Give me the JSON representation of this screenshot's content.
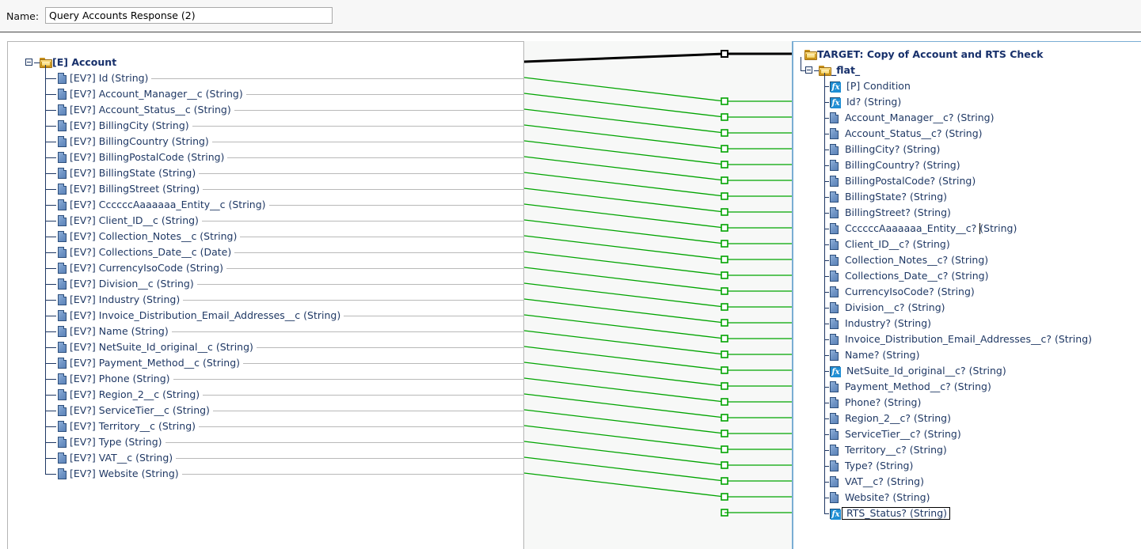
{
  "header": {
    "name_label": "Name:",
    "name_value": "Query Accounts Response (2)",
    "name_placeholder": "Name"
  },
  "colors": {
    "link_line": "#00a400",
    "root_link_line": "#000000",
    "tree_text": "#1f3864",
    "grey_connector": "#b9b9b9",
    "target_border": "#7aadd4",
    "folder_icon": "#f2c14e",
    "field_icon": "#6e93c4",
    "function_icon": "#1f8ed4"
  },
  "source_tree": {
    "root": {
      "label": "[E] Account",
      "icon": "folder-icon",
      "expanded": true
    },
    "fields": [
      {
        "label": "[EV?] Id (String)",
        "icon": "field-icon"
      },
      {
        "label": "[EV?] Account_Manager__c (String)",
        "icon": "field-icon"
      },
      {
        "label": "[EV?] Account_Status__c (String)",
        "icon": "field-icon"
      },
      {
        "label": "[EV?] BillingCity (String)",
        "icon": "field-icon"
      },
      {
        "label": "[EV?] BillingCountry (String)",
        "icon": "field-icon"
      },
      {
        "label": "[EV?] BillingPostalCode (String)",
        "icon": "field-icon"
      },
      {
        "label": "[EV?] BillingState (String)",
        "icon": "field-icon"
      },
      {
        "label": "[EV?] BillingStreet (String)",
        "icon": "field-icon"
      },
      {
        "label": "[EV?] CcccccAaaaaaa_Entity__c (String)",
        "icon": "field-icon"
      },
      {
        "label": "[EV?] Client_ID__c (String)",
        "icon": "field-icon"
      },
      {
        "label": "[EV?] Collection_Notes__c (String)",
        "icon": "field-icon"
      },
      {
        "label": "[EV?] Collections_Date__c (Date)",
        "icon": "field-icon"
      },
      {
        "label": "[EV?] CurrencyIsoCode (String)",
        "icon": "field-icon"
      },
      {
        "label": "[EV?] Division__c (String)",
        "icon": "field-icon"
      },
      {
        "label": "[EV?] Industry (String)",
        "icon": "field-icon"
      },
      {
        "label": "[EV?] Invoice_Distribution_Email_Addresses__c (String)",
        "icon": "field-icon"
      },
      {
        "label": "[EV?] Name (String)",
        "icon": "field-icon"
      },
      {
        "label": "[EV?] NetSuite_Id_original__c (String)",
        "icon": "field-icon"
      },
      {
        "label": "[EV?] Payment_Method__c (String)",
        "icon": "field-icon"
      },
      {
        "label": "[EV?] Phone (String)",
        "icon": "field-icon"
      },
      {
        "label": "[EV?] Region_2__c (String)",
        "icon": "field-icon"
      },
      {
        "label": "[EV?] ServiceTier__c (String)",
        "icon": "field-icon"
      },
      {
        "label": "[EV?] Territory__c (String)",
        "icon": "field-icon"
      },
      {
        "label": "[EV?] Type (String)",
        "icon": "field-icon"
      },
      {
        "label": "[EV?] VAT__c (String)",
        "icon": "field-icon"
      },
      {
        "label": "[EV?] Website (String)",
        "icon": "field-icon"
      }
    ]
  },
  "target_tree": {
    "root": {
      "label": "TARGET: Copy of Account and RTS Check",
      "icon": "folder-icon"
    },
    "group": {
      "label": "_flat_",
      "icon": "folder-icon",
      "expanded": true
    },
    "fields": [
      {
        "label": "[P] Condition",
        "icon": "function-icon",
        "selected": false
      },
      {
        "label": "Id? (String)",
        "icon": "function-icon",
        "selected": false
      },
      {
        "label": "Account_Manager__c? (String)",
        "icon": "field-icon",
        "selected": false
      },
      {
        "label": "Account_Status__c? (String)",
        "icon": "field-icon",
        "selected": false
      },
      {
        "label": "BillingCity? (String)",
        "icon": "field-icon",
        "selected": false
      },
      {
        "label": "BillingCountry? (String)",
        "icon": "field-icon",
        "selected": false
      },
      {
        "label": "BillingPostalCode? (String)",
        "icon": "field-icon",
        "selected": false
      },
      {
        "label": "BillingState? (String)",
        "icon": "field-icon",
        "selected": false
      },
      {
        "label": "BillingStreet? (String)",
        "icon": "field-icon",
        "selected": false
      },
      {
        "label": "CcccccAaaaaaa_Entity__c? (String)",
        "icon": "field-icon",
        "selected": false,
        "caret": true
      },
      {
        "label": "Client_ID__c? (String)",
        "icon": "field-icon",
        "selected": false
      },
      {
        "label": "Collection_Notes__c? (String)",
        "icon": "field-icon",
        "selected": false
      },
      {
        "label": "Collections_Date__c? (String)",
        "icon": "field-icon",
        "selected": false
      },
      {
        "label": "CurrencyIsoCode? (String)",
        "icon": "field-icon",
        "selected": false
      },
      {
        "label": "Division__c? (String)",
        "icon": "field-icon",
        "selected": false
      },
      {
        "label": "Industry? (String)",
        "icon": "field-icon",
        "selected": false
      },
      {
        "label": "Invoice_Distribution_Email_Addresses__c? (String)",
        "icon": "field-icon",
        "selected": false
      },
      {
        "label": "Name? (String)",
        "icon": "field-icon",
        "selected": false
      },
      {
        "label": "NetSuite_Id_original__c? (String)",
        "icon": "function-icon",
        "selected": false
      },
      {
        "label": "Payment_Method__c? (String)",
        "icon": "field-icon",
        "selected": false
      },
      {
        "label": "Phone? (String)",
        "icon": "field-icon",
        "selected": false
      },
      {
        "label": "Region_2__c? (String)",
        "icon": "field-icon",
        "selected": false
      },
      {
        "label": "ServiceTier__c? (String)",
        "icon": "field-icon",
        "selected": false
      },
      {
        "label": "Territory__c? (String)",
        "icon": "field-icon",
        "selected": false
      },
      {
        "label": "Type? (String)",
        "icon": "field-icon",
        "selected": false
      },
      {
        "label": "VAT__c? (String)",
        "icon": "field-icon",
        "selected": false
      },
      {
        "label": "Website? (String)",
        "icon": "field-icon",
        "selected": false
      },
      {
        "label": "RTS_Status? (String)",
        "icon": "function-icon",
        "selected": true
      }
    ]
  },
  "mappings": {
    "root_link": {
      "source_row": -1,
      "target_row": -1,
      "color": "#000000"
    },
    "links": [
      {
        "source": "[EV?] Id (String)",
        "target": "Id? (String)"
      },
      {
        "source": "[EV?] Account_Manager__c (String)",
        "target": "Account_Manager__c? (String)"
      },
      {
        "source": "[EV?] Account_Status__c (String)",
        "target": "Account_Status__c? (String)"
      },
      {
        "source": "[EV?] BillingCity (String)",
        "target": "BillingCity? (String)"
      },
      {
        "source": "[EV?] BillingCountry (String)",
        "target": "BillingCountry? (String)"
      },
      {
        "source": "[EV?] BillingPostalCode (String)",
        "target": "BillingPostalCode? (String)"
      },
      {
        "source": "[EV?] BillingState (String)",
        "target": "BillingState? (String)"
      },
      {
        "source": "[EV?] BillingStreet (String)",
        "target": "BillingStreet? (String)"
      },
      {
        "source": "[EV?] CcccccAaaaaaa_Entity__c (String)",
        "target": "CcccccAaaaaaa_Entity__c? (String)"
      },
      {
        "source": "[EV?] Client_ID__c (String)",
        "target": "Client_ID__c? (String)"
      },
      {
        "source": "[EV?] Collection_Notes__c (String)",
        "target": "Collection_Notes__c? (String)"
      },
      {
        "source": "[EV?] Collections_Date__c (Date)",
        "target": "Collections_Date__c? (String)"
      },
      {
        "source": "[EV?] CurrencyIsoCode (String)",
        "target": "CurrencyIsoCode? (String)"
      },
      {
        "source": "[EV?] Division__c (String)",
        "target": "Division__c? (String)"
      },
      {
        "source": "[EV?] Industry (String)",
        "target": "Industry? (String)"
      },
      {
        "source": "[EV?] Invoice_Distribution_Email_Addresses__c (String)",
        "target": "Invoice_Distribution_Email_Addresses__c? (String)"
      },
      {
        "source": "[EV?] Name (String)",
        "target": "Name? (String)"
      },
      {
        "source": "[EV?] NetSuite_Id_original__c (String)",
        "target": "NetSuite_Id_original__c? (String)"
      },
      {
        "source": "[EV?] Payment_Method__c (String)",
        "target": "Payment_Method__c? (String)"
      },
      {
        "source": "[EV?] Phone (String)",
        "target": "Phone? (String)"
      },
      {
        "source": "[EV?] Region_2__c (String)",
        "target": "Region_2__c? (String)"
      },
      {
        "source": "[EV?] ServiceTier__c (String)",
        "target": "ServiceTier__c? (String)"
      },
      {
        "source": "[EV?] Territory__c (String)",
        "target": "Territory__c? (String)"
      },
      {
        "source": "[EV?] Type (String)",
        "target": "Type? (String)"
      },
      {
        "source": "[EV?] VAT__c (String)",
        "target": "VAT__c? (String)"
      },
      {
        "source": "[EV?] Website (String)",
        "target": "Website? (String)"
      }
    ],
    "unlinked_targets": [
      "[P] Condition",
      "RTS_Status? (String)"
    ]
  }
}
